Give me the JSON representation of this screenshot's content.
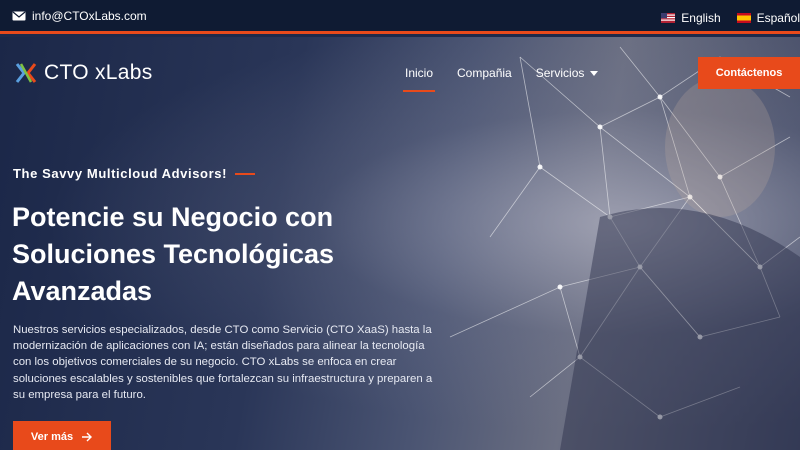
{
  "topbar": {
    "email": "info@CTOxLabs.com",
    "languages": [
      {
        "label": "English",
        "flag": "us-flag-icon"
      },
      {
        "label": "Español",
        "flag": "spain-flag-icon"
      }
    ]
  },
  "nav": {
    "brand": "CTO xLabs",
    "items": [
      "Inicio",
      "Compañia",
      "Servicios"
    ],
    "contact_label": "Contáctenos"
  },
  "hero": {
    "tagline": "The Savvy Multicloud Advisors!",
    "headline": "Potencie su Negocio con Soluciones Tecnológicas Avanzadas",
    "description": "Nuestros servicios especializados, desde CTO como Servicio (CTO XaaS) hasta la modernización de aplicaciones con IA; están diseñados para alinear la tecnología con los objetivos comerciales de su negocio. CTO xLabs se enfoca en crear soluciones escalables y sostenibles que fortalezcan su infraestructura y preparen a su empresa para el futuro.",
    "button_label": "Ver más"
  },
  "colors": {
    "accent": "#e84a1b",
    "topbar_bg": "#0f1b33"
  }
}
